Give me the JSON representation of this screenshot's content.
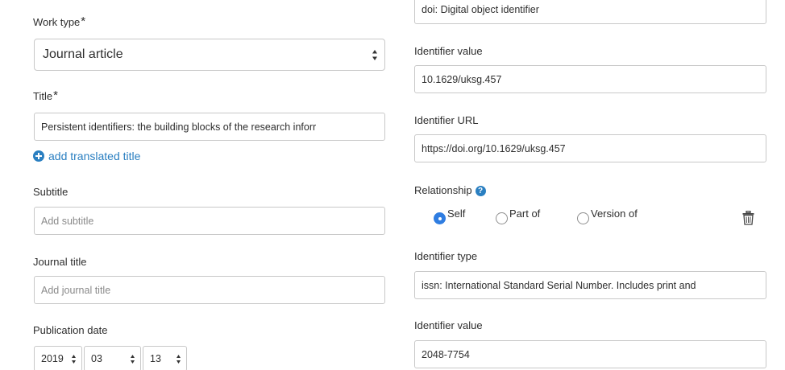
{
  "left": {
    "work_type": {
      "label": "Work type",
      "required": "*",
      "value": "Journal article"
    },
    "title": {
      "label": "Title",
      "required": "*",
      "value": "Persistent identifiers: the building blocks of the research inforr"
    },
    "add_translated_title": "add translated title",
    "subtitle": {
      "label": "Subtitle",
      "placeholder": "Add subtitle"
    },
    "journal_title": {
      "label": "Journal title",
      "placeholder": "Add journal title"
    },
    "publication_date": {
      "label": "Publication date",
      "year": "2019",
      "month": "03",
      "day": "13"
    }
  },
  "right": {
    "identifier_1": {
      "type_value": "doi: Digital object identifier",
      "value_label": "Identifier value",
      "value": "10.1629/uksg.457",
      "url_label": "Identifier URL",
      "url": "https://doi.org/10.1629/uksg.457"
    },
    "relationship": {
      "label": "Relationship",
      "help_glyph": "?",
      "options": [
        "Self",
        "Part of",
        "Version of"
      ],
      "selected": "Self"
    },
    "identifier_2": {
      "type_label": "Identifier type",
      "type_value": "issn: International Standard Serial Number. Includes print and",
      "value_label": "Identifier value",
      "value": "2048-7754"
    }
  },
  "colors": {
    "link": "#2a7fc1",
    "radio_selected": "#2f7de1",
    "border": "#c8c8c8"
  },
  "icons": [
    "updown-arrows-icon",
    "plus-circle-icon",
    "help-icon",
    "trash-icon"
  ]
}
